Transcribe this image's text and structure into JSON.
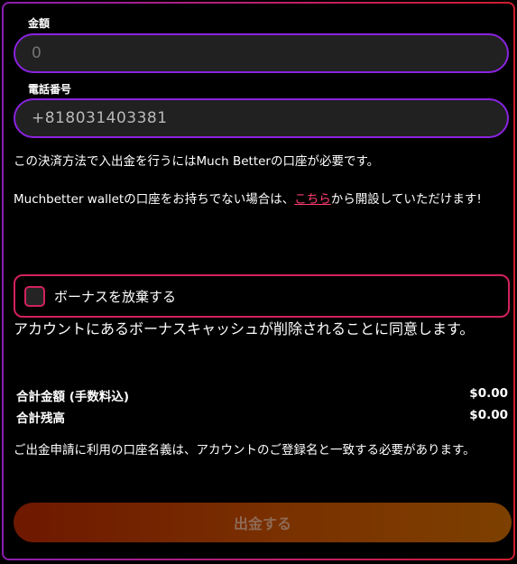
{
  "amount": {
    "label": "金額",
    "placeholder": "0"
  },
  "phone": {
    "label": "電話番号",
    "value": "+818031403381"
  },
  "info": {
    "line1": "この決済方法で入出金を行うにはMuch Betterの口座が必要です。",
    "line2_before": "Muchbetter walletの口座をお持ちでない場合は、",
    "line2_link": "こちら",
    "line2_after": "から開設していただけます!"
  },
  "bonus": {
    "checkbox_label": "ボーナスを放棄する",
    "checked": false,
    "consent": "アカウントにあるボーナスキャッシュが削除されることに同意します。"
  },
  "summary": {
    "total_label": "合計金額 (手数料込)",
    "total_value": "$0.00",
    "balance_label": "合計残高",
    "balance_value": "$0.00"
  },
  "notice": "ご出金申請に利用の口座名義は、アカウントのご登録名と一致する必要があります。",
  "submit": {
    "label": "出金する",
    "enabled": false
  },
  "colors": {
    "input_border": "#8a23e0",
    "bonus_border": "#d3215e",
    "link": "#ff3d6e",
    "button_gradient_start": "#6e1800",
    "button_gradient_end": "#7d4000"
  }
}
